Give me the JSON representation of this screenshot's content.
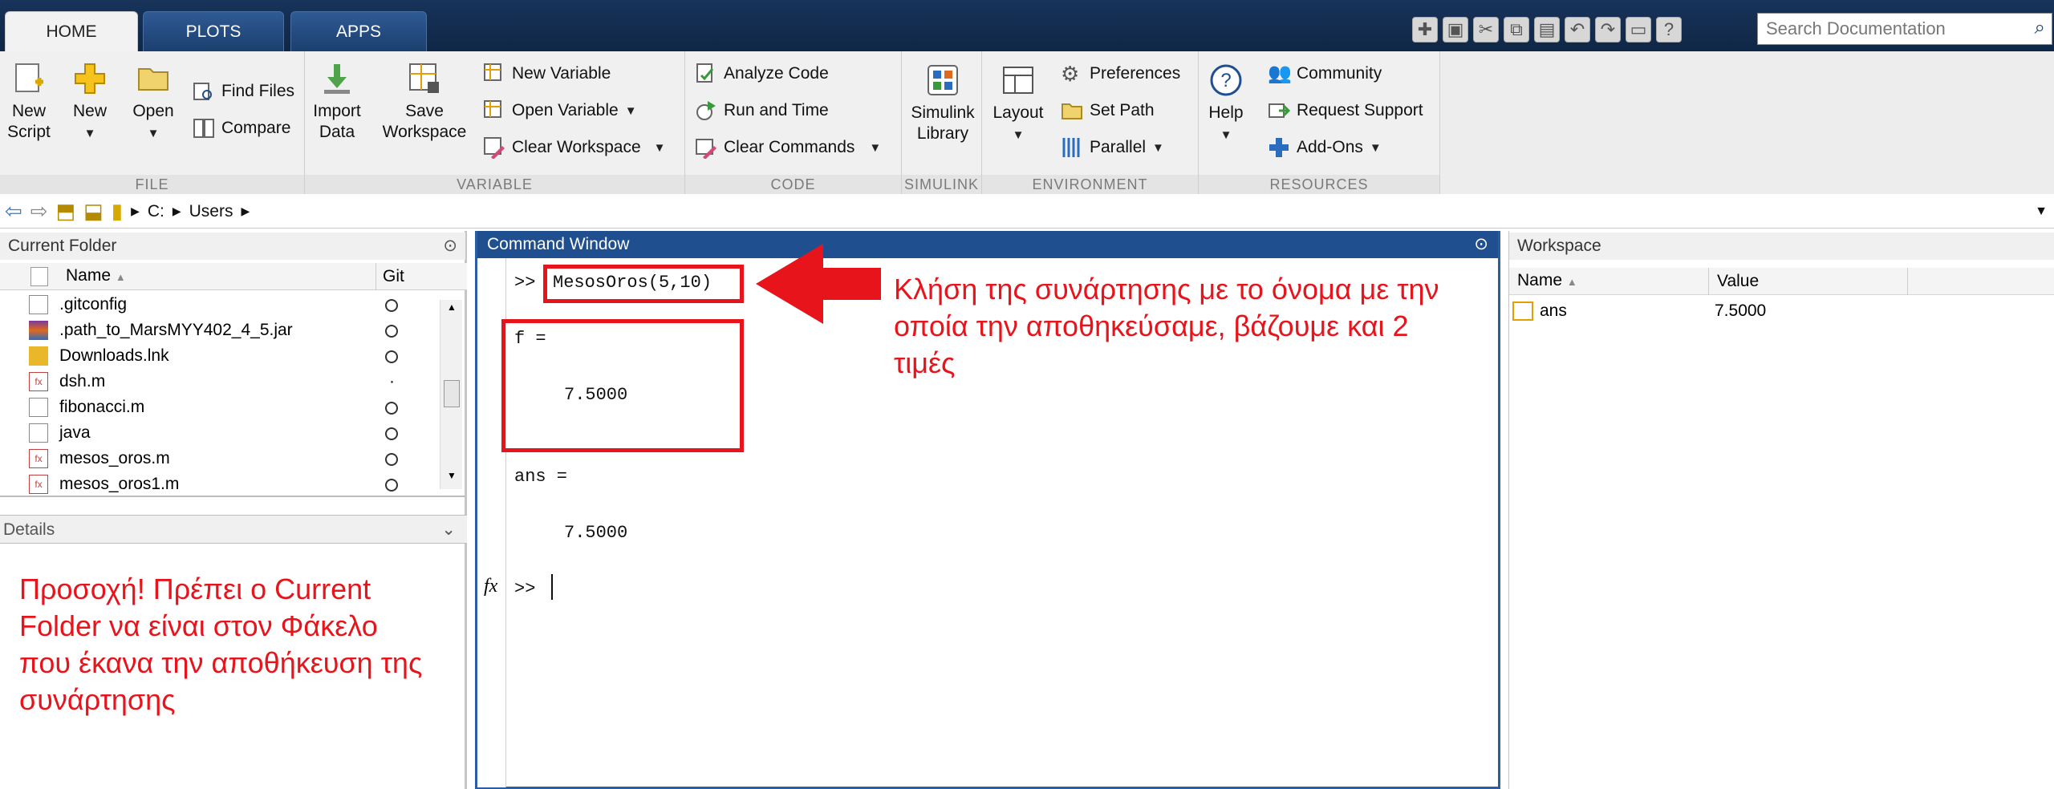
{
  "tabs": [
    "HOME",
    "PLOTS",
    "APPS"
  ],
  "search": {
    "placeholder": "Search Documentation"
  },
  "ribbon": {
    "file": {
      "label": "FILE",
      "new_script": [
        "New",
        "Script"
      ],
      "new": "New",
      "open": "Open",
      "find_files": "Find Files",
      "compare": "Compare"
    },
    "variable": {
      "label": "VARIABLE",
      "import": [
        "Import",
        "Data"
      ],
      "save": [
        "Save",
        "Workspace"
      ],
      "new_variable": "New Variable",
      "open_variable": "Open Variable",
      "clear_workspace": "Clear Workspace"
    },
    "code": {
      "label": "CODE",
      "analyze": "Analyze Code",
      "run_time": "Run and Time",
      "clear_commands": "Clear Commands"
    },
    "simulink": {
      "label": "SIMULINK",
      "library": [
        "Simulink",
        "Library"
      ]
    },
    "environment": {
      "label": "ENVIRONMENT",
      "layout": "Layout",
      "preferences": "Preferences",
      "set_path": "Set Path",
      "parallel": "Parallel"
    },
    "resources": {
      "label": "RESOURCES",
      "help": "Help",
      "community": "Community",
      "request_support": "Request Support",
      "addons": "Add-Ons"
    }
  },
  "address": {
    "drive": "C:",
    "folder": "Users"
  },
  "current_folder": {
    "title": "Current Folder",
    "col_name": "Name",
    "col_git": "Git",
    "files": [
      ".gitconfig",
      ".path_to_MarsMYY402_4_5.jar",
      "Downloads.lnk",
      "dsh.m",
      "fibonacci.m",
      "java",
      "mesos_oros.m",
      "mesos_oros1.m"
    ],
    "details": "Details",
    "note": "Προσοχή! Πρέπει ο Current Folder να είναι στον Φάκελο που έκανα την αποθήκευση της συνάρτησης"
  },
  "command_window": {
    "title": "Command Window",
    "prompt": ">>",
    "command": "MesosOros(5,10)",
    "f_label": "f =",
    "f_value": "7.5000",
    "ans_label": "ans =",
    "ans_value": "7.5000",
    "fx": "fx",
    "annotation": "Κλήση της συνάρτησης με το όνομα με την οποία την αποθηκεύσαμε, βάζουμε και 2 τιμές"
  },
  "workspace": {
    "title": "Workspace",
    "col_name": "Name",
    "col_value": "Value",
    "vars": [
      {
        "name": "ans",
        "value": "7.5000"
      }
    ]
  },
  "colors": {
    "accent": "#1f4f8f",
    "annotation": "#e8141c"
  }
}
